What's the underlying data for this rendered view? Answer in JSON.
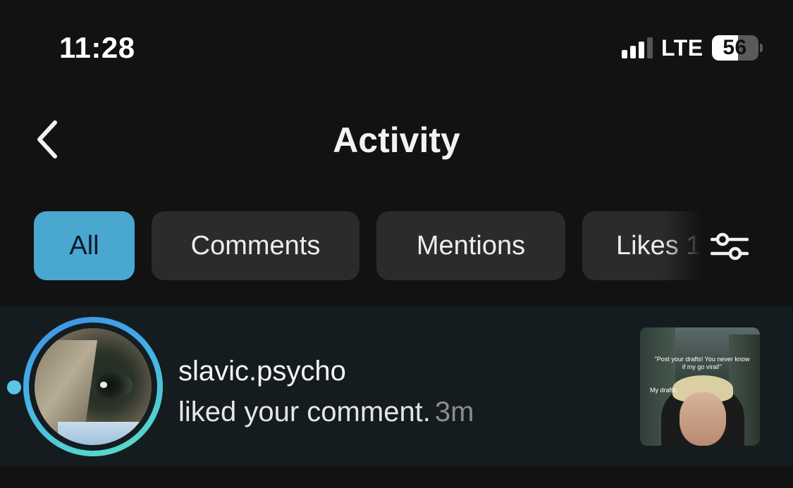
{
  "status_bar": {
    "time": "11:28",
    "network": "LTE",
    "battery_percent": "56",
    "battery_level": 0.56,
    "signal_bars_active": 3
  },
  "header": {
    "back_icon": "chevron-left-icon",
    "title": "Activity"
  },
  "tabs": [
    {
      "label": "All",
      "active": true
    },
    {
      "label": "Comments",
      "active": false
    },
    {
      "label": "Mentions",
      "active": false
    },
    {
      "label": "Likes 1",
      "active": false
    }
  ],
  "filter_icon": "sliders-icon",
  "activity": [
    {
      "username": "slavic.psycho",
      "action": "liked your comment.",
      "time": "3m",
      "unread": true,
      "thumbnail": {
        "caption_top": "\"Post your drafts! You never know if my go viral!\"",
        "caption_side": "My drafts:"
      }
    }
  ],
  "colors": {
    "background": "#121212",
    "active_tab": "#4aa7d0",
    "chip": "#2b2b2b",
    "row_highlight": "#141c20",
    "unread_dot": "#5cc4ea"
  }
}
